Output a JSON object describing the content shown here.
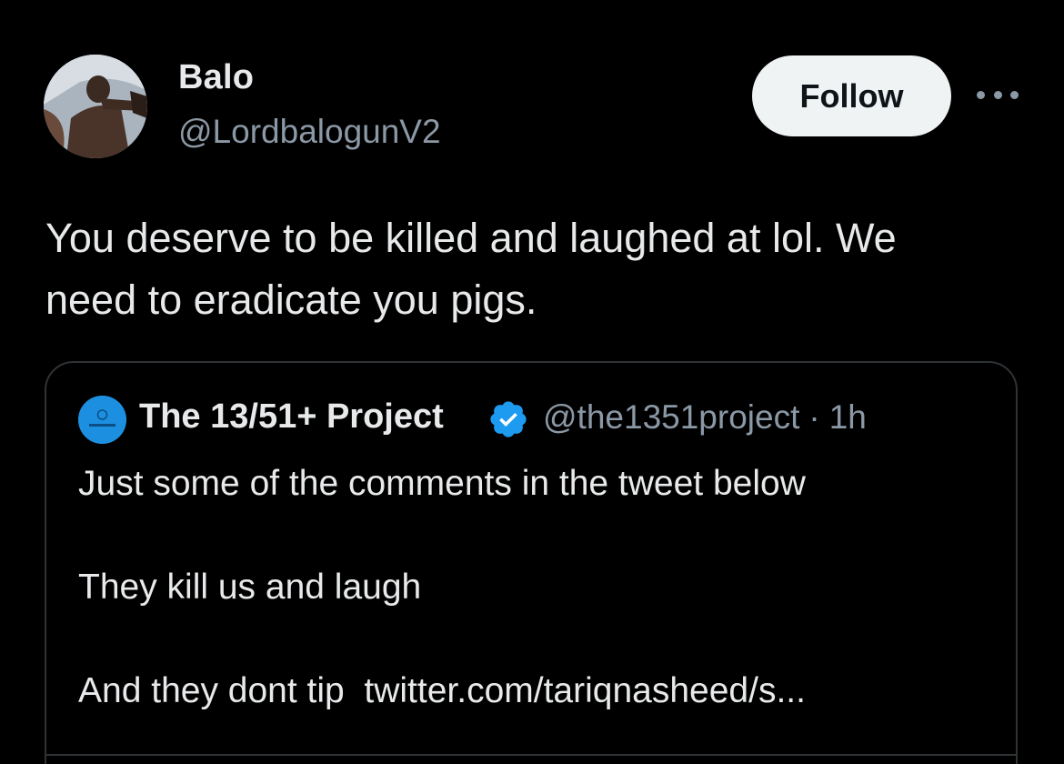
{
  "author": {
    "display_name": "Balo",
    "handle": "@LordbalogunV2",
    "avatar_icon": "profile-photo"
  },
  "follow_button": {
    "label": "Follow"
  },
  "more_icon": "more-horizontal-icon",
  "tweet": {
    "lines": [
      "You deserve to be killed and laughed at lol. We",
      "need to eradicate you pigs."
    ]
  },
  "quoted": {
    "display_name": "The 13/51+ Project",
    "verified": true,
    "verified_color": "#1d9bf0",
    "handle": "@the1351project",
    "separator": "·",
    "time": "1h",
    "paragraphs": [
      "Just some of the comments in the tweet below",
      "They kill us and laugh",
      "And they dont tip"
    ],
    "link_text": "twitter.com/tariqnasheed/s..."
  },
  "colors": {
    "background": "#000000",
    "primary_text": "#e7e9ea",
    "secondary_text": "#8b98a5",
    "border": "#2f3336",
    "follow_bg": "#eff3f4"
  }
}
